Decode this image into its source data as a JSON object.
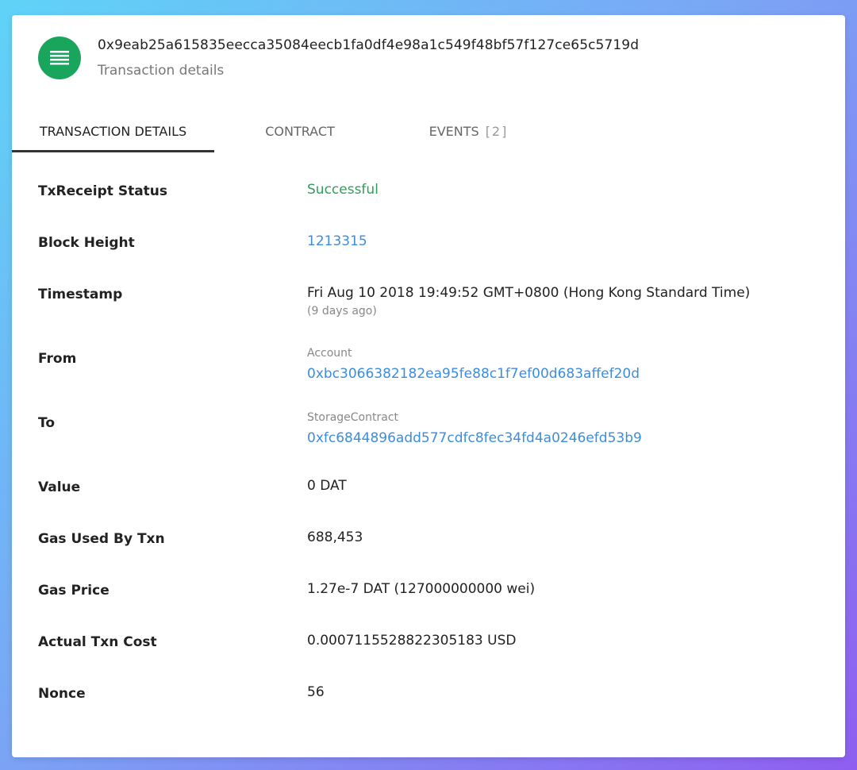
{
  "header": {
    "tx_hash": "0x9eab25a615835eecca35084eecb1fa0df4e98a1c549f48bf57f127ce65c5719d",
    "subtitle": "Transaction details",
    "icon": "list-icon",
    "icon_color": "#1aa55c"
  },
  "tabs": [
    {
      "label": "TRANSACTION DETAILS",
      "active": true
    },
    {
      "label": "CONTRACT",
      "active": false
    },
    {
      "label": "EVENTS",
      "count": "[2]",
      "active": false
    }
  ],
  "details": {
    "status": {
      "label": "TxReceipt Status",
      "value": "Successful"
    },
    "block_height": {
      "label": "Block Height",
      "value": "1213315"
    },
    "timestamp": {
      "label": "Timestamp",
      "value": "Fri Aug 10 2018 19:49:52 GMT+0800 (Hong Kong Standard Time)",
      "relative": "(9 days ago)"
    },
    "from": {
      "label": "From",
      "type": "Account",
      "value": "0xbc3066382182ea95fe88c1f7ef00d683affef20d"
    },
    "to": {
      "label": "To",
      "type": "StorageContract",
      "value": "0xfc6844896add577cdfc8fec34fd4a0246efd53b9"
    },
    "value": {
      "label": "Value",
      "value": "0 DAT"
    },
    "gas_used": {
      "label": "Gas Used By Txn",
      "value": "688,453"
    },
    "gas_price": {
      "label": "Gas Price",
      "value": "1.27e-7 DAT (127000000000 wei)"
    },
    "actual_cost": {
      "label": "Actual Txn Cost",
      "value": "0.0007115528822305183 USD"
    },
    "nonce": {
      "label": "Nonce",
      "value": "56"
    }
  },
  "colors": {
    "success": "#2f9e5a",
    "link": "#3c8de0"
  }
}
